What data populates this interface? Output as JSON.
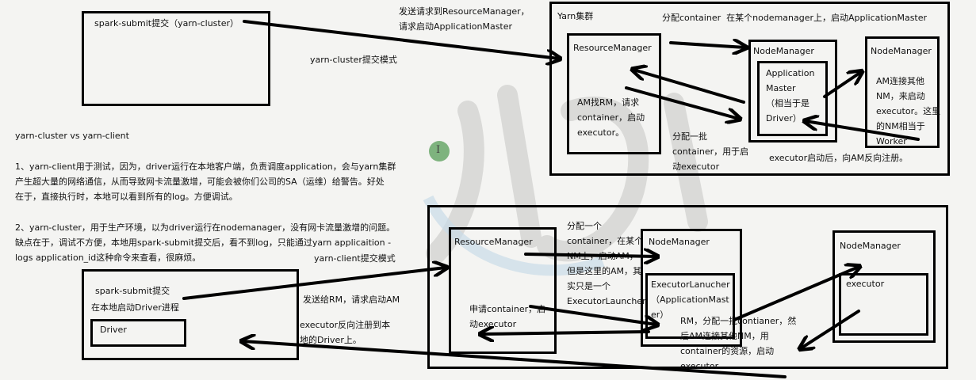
{
  "top": {
    "submit_box": "spark-submit提交（yarn-cluster）",
    "mode_label": "yarn-cluster提交模式",
    "arrow_label": "发送请求到ResourceManager，\n请求启动ApplicationMaster",
    "cluster_title": "Yarn集群",
    "cluster_note": "分配container  在某个nodemanager上，启动ApplicationMaster",
    "rm_title": "ResourceManager",
    "rm_text": "AM找RM，请求\ncontainer，启动\nexecutor。",
    "nm1_title": "NodeManager",
    "am_text": "Application\nMaster\n（相当于是\nDriver）",
    "nm2_title": "NodeManager",
    "nm2_text": "AM连接其他\nNM，来启动\nexecutor。这里\n的NM相当于\nWorker",
    "batch_label": "分配一批\ncontainer，用于启\n动executor",
    "register_label": "executor启动后，向AM反向注册。"
  },
  "notes": {
    "heading": "yarn-cluster vs yarn-client",
    "p1": "1、yarn-client用于测试，因为，driver运行在本地客户端，负责调度application，会与yarn集群\n产生超大量的网络通信，从而导致网卡流量激增，可能会被你们公司的SA（运维）给警告。好处\n在于，直接执行时，本地可以看到所有的log。方便调试。",
    "p2": "2、yarn-cluster，用于生产环境，以为driver运行在nodemanager，没有网卡流量激增的问题。\n缺点在于，调试不方便，本地用spark-submit提交后，看不到log，只能通过yarn applicaition -\nlogs application_id这种命令来查看，很麻烦。"
  },
  "bottom": {
    "mode_label": "yarn-client提交模式",
    "submit_title": "spark-submit提交",
    "submit_sub": "在本地启动Driver进程",
    "driver": "Driver",
    "send_label": "发送给RM，请求启动AM",
    "register_label": "executor反向注册到本\n地的Driver上。",
    "rm_title": "ResourceManager",
    "rm_text": "申请container，启\n动executor",
    "alloc_label": "分配一个\ncontainer，在某个\nNM上，启动AM，\n但是这里的AM，其\n实只是一个\nExecutorLauncher",
    "nm1_title": "NodeManager",
    "launcher_text": "ExecutorLanucher\n（ApplicationMast\ner）",
    "rm_note": "RM，分配一批contianer，然\n后AM连接其他NM，用\ncontainer的资源，启动\nexecutor",
    "nm2_title": "NodeManager",
    "executor": "executor"
  }
}
